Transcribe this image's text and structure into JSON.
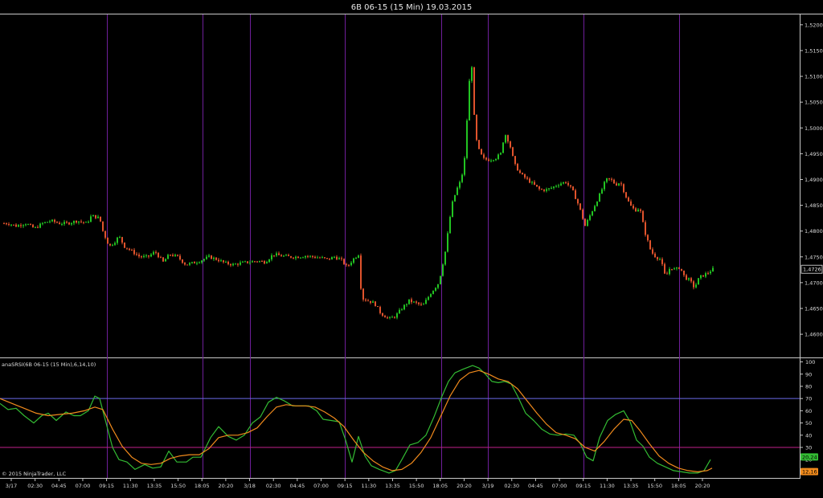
{
  "window": {
    "title": "6B 06-15 (15 Min)  19.03.2015"
  },
  "copyright": "© 2015 NinjaTrader, LLC",
  "indicator_label": "anaSRSI(6B 06-15 (15 Min),6,14,10)",
  "colors": {
    "background": "#000000",
    "up_bar": "#22c422",
    "down_bar": "#e0532c",
    "session_line": "#6f1f9a",
    "fast_line": "#33bb33",
    "slow_line": "#f08a1c",
    "upper_band": "#6a6ae8",
    "lower_band": "#c0208a",
    "axis": "#c8c8c8"
  },
  "chart_data": [
    {
      "type": "candlestick",
      "title": "6B 06-15 (15 Min)  19.03.2015",
      "y_ticks": [
        "1,5200",
        "1,5150",
        "1,5100",
        "1,5050",
        "1,5000",
        "1,4950",
        "1,4900",
        "1,4850",
        "1,4800",
        "1,4750",
        "1,4700",
        "1,4650",
        "1,4600"
      ],
      "ylim": [
        1.4555,
        1.522
      ],
      "last_price_label": "1,4726",
      "last_price": 1.4726,
      "x_labels": [
        "3/17",
        "02:30",
        "04:45",
        "07:00",
        "09:15",
        "11:30",
        "13:35",
        "15:50",
        "18:05",
        "20:20",
        "3/18",
        "02:30",
        "04:45",
        "07:00",
        "09:15",
        "11:30",
        "13:35",
        "15:50",
        "18:05",
        "20:20",
        "3/19",
        "02:30",
        "04:45",
        "07:00",
        "09:15",
        "11:30",
        "13:35",
        "15:50",
        "18:05",
        "20:20"
      ],
      "session_separators": [
        "07:00",
        "13:35",
        "3/18",
        "07:00",
        "13:35",
        "3/19",
        "07:00",
        "13:35"
      ],
      "price_path": [
        [
          0,
          1.4815
        ],
        [
          12,
          1.4815
        ],
        [
          22,
          1.481
        ],
        [
          34,
          1.4815
        ],
        [
          45,
          1.4805
        ],
        [
          55,
          1.4815
        ],
        [
          65,
          1.482
        ],
        [
          76,
          1.4815
        ],
        [
          86,
          1.4815
        ],
        [
          98,
          1.482
        ],
        [
          110,
          1.4815
        ],
        [
          116,
          1.483
        ],
        [
          126,
          1.4825
        ],
        [
          130,
          1.48
        ],
        [
          138,
          1.477
        ],
        [
          145,
          1.478
        ],
        [
          150,
          1.479
        ],
        [
          157,
          1.477
        ],
        [
          167,
          1.476
        ],
        [
          176,
          1.475
        ],
        [
          186,
          1.475
        ],
        [
          195,
          1.476
        ],
        [
          205,
          1.474
        ],
        [
          213,
          1.4755
        ],
        [
          223,
          1.475
        ],
        [
          233,
          1.4735
        ],
        [
          242,
          1.4738
        ],
        [
          252,
          1.4743
        ],
        [
          262,
          1.475
        ],
        [
          272,
          1.4745
        ],
        [
          282,
          1.4738
        ],
        [
          292,
          1.4735
        ],
        [
          302,
          1.4738
        ],
        [
          312,
          1.474
        ],
        [
          322,
          1.4742
        ],
        [
          332,
          1.474
        ],
        [
          342,
          1.4755
        ],
        [
          352,
          1.4752
        ],
        [
          362,
          1.475
        ],
        [
          372,
          1.475
        ],
        [
          382,
          1.4752
        ],
        [
          392,
          1.475
        ],
        [
          402,
          1.4748
        ],
        [
          410,
          1.4745
        ],
        [
          418,
          1.475
        ],
        [
          426,
          1.4745
        ],
        [
          434,
          1.473
        ],
        [
          441,
          1.4745
        ],
        [
          448,
          1.4755
        ],
        [
          452,
          1.467
        ],
        [
          460,
          1.4665
        ],
        [
          468,
          1.466
        ],
        [
          476,
          1.464
        ],
        [
          486,
          1.463
        ],
        [
          494,
          1.4635
        ],
        [
          502,
          1.465
        ],
        [
          511,
          1.4665
        ],
        [
          520,
          1.466
        ],
        [
          528,
          1.4655
        ],
        [
          538,
          1.468
        ],
        [
          548,
          1.47
        ],
        [
          556,
          1.476
        ],
        [
          564,
          1.485
        ],
        [
          570,
          1.488
        ],
        [
          576,
          1.49
        ],
        [
          581,
          1.495
        ],
        [
          585,
          1.508
        ],
        [
          589,
          1.512
        ],
        [
          593,
          1.499
        ],
        [
          597,
          1.496
        ],
        [
          603,
          1.494
        ],
        [
          611,
          1.4938
        ],
        [
          619,
          1.4942
        ],
        [
          625,
          1.495
        ],
        [
          630,
          1.499
        ],
        [
          636,
          1.497
        ],
        [
          642,
          1.493
        ],
        [
          650,
          1.491
        ],
        [
          658,
          1.49
        ],
        [
          666,
          1.489
        ],
        [
          674,
          1.488
        ],
        [
          682,
          1.488
        ],
        [
          690,
          1.4885
        ],
        [
          698,
          1.4892
        ],
        [
          706,
          1.4895
        ],
        [
          714,
          1.488
        ],
        [
          722,
          1.485
        ],
        [
          730,
          1.481
        ],
        [
          736,
          1.483
        ],
        [
          742,
          1.485
        ],
        [
          748,
          1.487
        ],
        [
          756,
          1.49
        ],
        [
          762,
          1.49
        ],
        [
          768,
          1.489
        ],
        [
          774,
          1.4895
        ],
        [
          780,
          1.487
        ],
        [
          786,
          1.485
        ],
        [
          792,
          1.484
        ],
        [
          798,
          1.4845
        ],
        [
          804,
          1.48
        ],
        [
          812,
          1.476
        ],
        [
          818,
          1.475
        ],
        [
          824,
          1.4745
        ],
        [
          830,
          1.471
        ],
        [
          836,
          1.473
        ],
        [
          842,
          1.4725
        ],
        [
          848,
          1.473
        ],
        [
          854,
          1.471
        ],
        [
          860,
          1.4705
        ],
        [
          866,
          1.469
        ],
        [
          872,
          1.471
        ],
        [
          878,
          1.4715
        ],
        [
          884,
          1.472
        ],
        [
          888,
          1.4726
        ]
      ]
    },
    {
      "type": "line",
      "title": "anaSRSI(6B 06-15 (15 Min),6,14,10)",
      "ylim": [
        5,
        103
      ],
      "y_ticks": [
        "100",
        "90",
        "80",
        "70",
        "60",
        "50",
        "40",
        "30",
        "20",
        "10"
      ],
      "reference_lines": [
        70,
        30
      ],
      "last_value_labels": [
        "20,24",
        "12,16"
      ],
      "series": [
        {
          "values": [
            [
              0,
              66
            ],
            [
              10,
              61
            ],
            [
              20,
              62
            ],
            [
              30,
              56
            ],
            [
              42,
              50
            ],
            [
              52,
              56
            ],
            [
              60,
              58
            ],
            [
              70,
              52
            ],
            [
              82,
              59
            ],
            [
              92,
              56
            ],
            [
              100,
              56
            ],
            [
              110,
              60
            ],
            [
              118,
              72
            ],
            [
              124,
              70
            ],
            [
              130,
              55
            ],
            [
              140,
              30
            ],
            [
              148,
              20
            ],
            [
              158,
              18
            ],
            [
              168,
              12
            ],
            [
              180,
              16
            ],
            [
              190,
              13
            ],
            [
              200,
              14
            ],
            [
              210,
              27
            ],
            [
              220,
              18
            ],
            [
              232,
              18
            ],
            [
              240,
              22
            ],
            [
              250,
              22
            ],
            [
              262,
              38
            ],
            [
              272,
              47
            ],
            [
              284,
              39
            ],
            [
              294,
              36
            ],
            [
              304,
              40
            ],
            [
              314,
              50
            ],
            [
              324,
              55
            ],
            [
              334,
              67
            ],
            [
              344,
              71
            ],
            [
              354,
              68
            ],
            [
              364,
              64
            ],
            [
              374,
              64
            ],
            [
              384,
              64
            ],
            [
              394,
              60
            ],
            [
              402,
              53
            ],
            [
              412,
              52
            ],
            [
              422,
              51
            ],
            [
              430,
              36
            ],
            [
              438,
              18
            ],
            [
              446,
              39
            ],
            [
              454,
              23
            ],
            [
              462,
              15
            ],
            [
              472,
              12
            ],
            [
              484,
              9
            ],
            [
              492,
              11
            ],
            [
              500,
              20
            ],
            [
              510,
              32
            ],
            [
              520,
              34
            ],
            [
              530,
              40
            ],
            [
              540,
              55
            ],
            [
              550,
              72
            ],
            [
              558,
              84
            ],
            [
              566,
              91
            ],
            [
              576,
              94
            ],
            [
              588,
              97
            ],
            [
              596,
              95
            ],
            [
              604,
              90
            ],
            [
              612,
              84
            ],
            [
              620,
              83
            ],
            [
              628,
              84
            ],
            [
              636,
              82
            ],
            [
              644,
              72
            ],
            [
              654,
              58
            ],
            [
              664,
              52
            ],
            [
              674,
              45
            ],
            [
              684,
              41
            ],
            [
              694,
              40
            ],
            [
              704,
              41
            ],
            [
              714,
              40
            ],
            [
              722,
              33
            ],
            [
              730,
              22
            ],
            [
              738,
              19
            ],
            [
              746,
              38
            ],
            [
              756,
              52
            ],
            [
              766,
              57
            ],
            [
              776,
              60
            ],
            [
              784,
              51
            ],
            [
              792,
              36
            ],
            [
              800,
              31
            ],
            [
              808,
              22
            ],
            [
              818,
              17
            ],
            [
              828,
              14
            ],
            [
              838,
              11
            ],
            [
              848,
              10
            ],
            [
              858,
              9
            ],
            [
              868,
              9
            ],
            [
              876,
              11
            ],
            [
              884,
              20
            ]
          ]
        },
        {
          "values": [
            [
              0,
              70
            ],
            [
              15,
              66
            ],
            [
              30,
              62
            ],
            [
              45,
              58
            ],
            [
              60,
              56
            ],
            [
              75,
              57
            ],
            [
              90,
              58
            ],
            [
              105,
              60
            ],
            [
              118,
              63
            ],
            [
              128,
              61
            ],
            [
              140,
              45
            ],
            [
              152,
              31
            ],
            [
              164,
              22
            ],
            [
              176,
              17
            ],
            [
              188,
              16
            ],
            [
              200,
              17
            ],
            [
              212,
              21
            ],
            [
              224,
              23
            ],
            [
              236,
              24
            ],
            [
              248,
              24
            ],
            [
              260,
              29
            ],
            [
              272,
              38
            ],
            [
              284,
              40
            ],
            [
              296,
              40
            ],
            [
              308,
              42
            ],
            [
              320,
              46
            ],
            [
              332,
              55
            ],
            [
              344,
              63
            ],
            [
              356,
              65
            ],
            [
              368,
              64
            ],
            [
              380,
              64
            ],
            [
              392,
              63
            ],
            [
              404,
              59
            ],
            [
              416,
              54
            ],
            [
              428,
              47
            ],
            [
              440,
              36
            ],
            [
              452,
              26
            ],
            [
              464,
              19
            ],
            [
              476,
              14
            ],
            [
              488,
              11
            ],
            [
              500,
              12
            ],
            [
              512,
              17
            ],
            [
              524,
              26
            ],
            [
              536,
              38
            ],
            [
              548,
              55
            ],
            [
              560,
              72
            ],
            [
              572,
              85
            ],
            [
              584,
              91
            ],
            [
              596,
              93
            ],
            [
              608,
              90
            ],
            [
              620,
              86
            ],
            [
              632,
              84
            ],
            [
              644,
              78
            ],
            [
              656,
              68
            ],
            [
              668,
              58
            ],
            [
              680,
              49
            ],
            [
              692,
              42
            ],
            [
              704,
              40
            ],
            [
              716,
              37
            ],
            [
              728,
              30
            ],
            [
              740,
              27
            ],
            [
              752,
              35
            ],
            [
              764,
              45
            ],
            [
              776,
              53
            ],
            [
              786,
              52
            ],
            [
              796,
              44
            ],
            [
              808,
              33
            ],
            [
              820,
              23
            ],
            [
              832,
              17
            ],
            [
              844,
              13
            ],
            [
              856,
              11
            ],
            [
              868,
              10
            ],
            [
              880,
              11
            ],
            [
              886,
              13
            ]
          ]
        }
      ]
    }
  ]
}
